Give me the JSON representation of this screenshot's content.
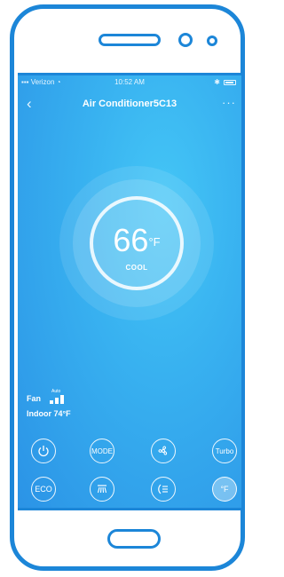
{
  "status_bar": {
    "carrier": "Verizon",
    "time": "10:52 AM"
  },
  "nav": {
    "title": "Air Conditioner5C13",
    "back_icon": "chevron-left-icon",
    "more_icon": "more-dots-icon"
  },
  "thermostat": {
    "temperature": "66",
    "unit": "°F",
    "mode": "COOL"
  },
  "fan": {
    "label": "Fan",
    "speed_label": "Auto",
    "speed_level": 3
  },
  "indoor": {
    "text": "Indoor 74°F"
  },
  "controls": {
    "power_icon": "power-icon",
    "mode_label": "MODE",
    "fan_icon": "fan-icon",
    "turbo_label": "Turbo",
    "eco_label": "ECO",
    "swing_icon": "swing-icon",
    "airflow_icon": "airflow-icon",
    "unit_label": "°F"
  },
  "colors": {
    "accent": "#1c86d8",
    "screen_bg": "#38b1f0"
  }
}
